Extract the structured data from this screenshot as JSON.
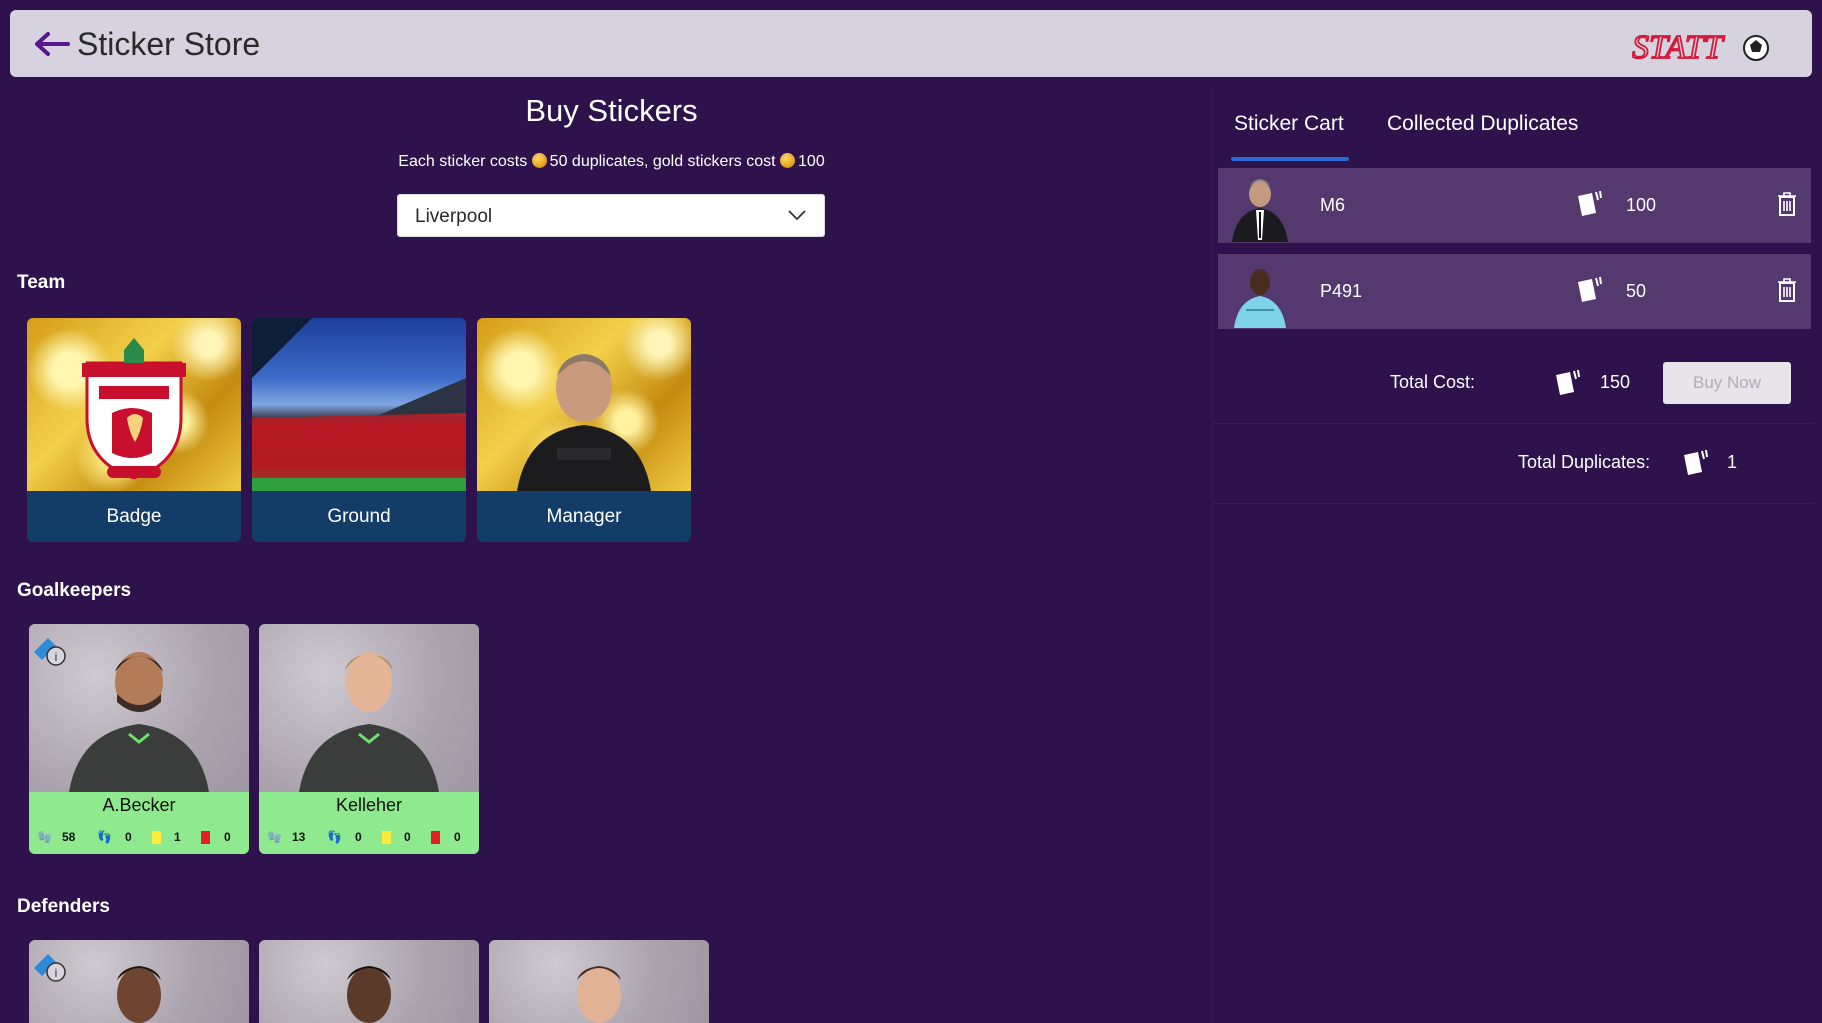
{
  "header": {
    "title": "Sticker Store",
    "back_icon": "arrow-left-icon",
    "logo": "STATTO"
  },
  "store": {
    "title": "Buy Stickers",
    "subtitle_part1": "Each sticker costs",
    "subtitle_part2": "50 duplicates, gold stickers cost",
    "subtitle_part3": "100",
    "team_select": "Liverpool"
  },
  "sections": {
    "team": "Team",
    "goalkeepers": "Goalkeepers",
    "defenders": "Defenders"
  },
  "team_cards": [
    {
      "label": "Badge"
    },
    {
      "label": "Ground"
    },
    {
      "label": "Manager"
    }
  ],
  "goalkeepers": [
    {
      "name": "A.Becker",
      "clean_sheets": "58",
      "assists": "0",
      "yellow": "1",
      "red": "0"
    },
    {
      "name": "Kelleher",
      "clean_sheets": "13",
      "assists": "0",
      "yellow": "0",
      "red": "0"
    }
  ],
  "tabs": {
    "cart": "Sticker Cart",
    "duplicates": "Collected Duplicates"
  },
  "cart": [
    {
      "code": "M6",
      "price": "100"
    },
    {
      "code": "P491",
      "price": "50"
    }
  ],
  "totals": {
    "cost_label": "Total Cost:",
    "cost_value": "150",
    "buy_label": "Buy Now",
    "dup_label": "Total Duplicates:",
    "dup_value": "1"
  },
  "colors": {
    "background": "#2e124b",
    "header": "#d7d2df",
    "accent_tab": "#2b6bd8",
    "card_band": "#133c66",
    "player_band": "#8fe98f"
  }
}
